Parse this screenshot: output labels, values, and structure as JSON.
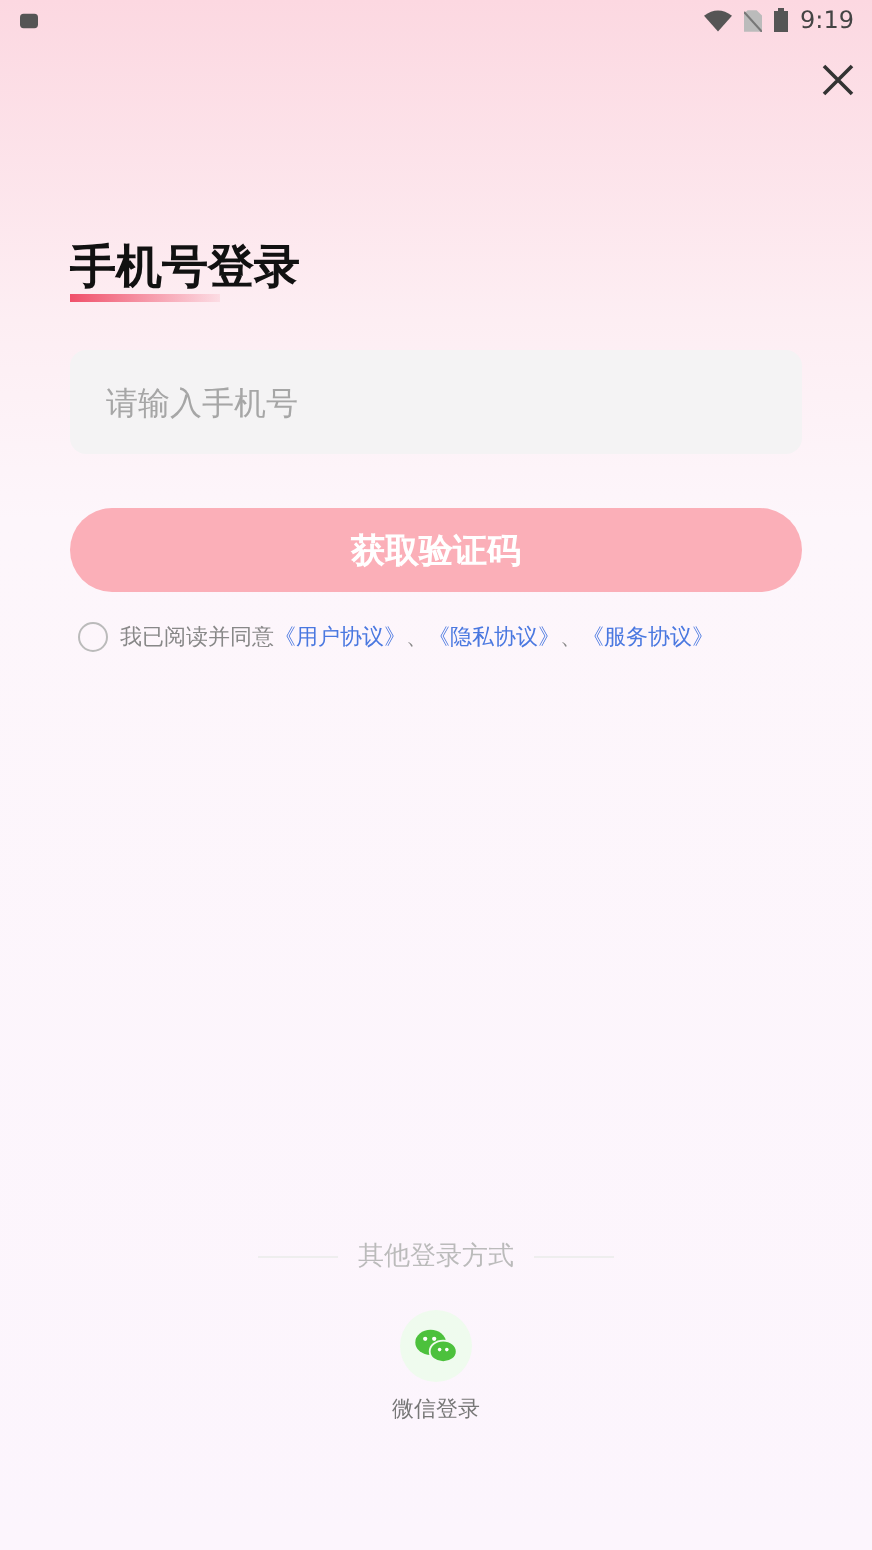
{
  "status_bar": {
    "time": "9:19"
  },
  "title": "手机号登录",
  "phone_field": {
    "placeholder": "请输入手机号"
  },
  "submit_button": {
    "label": "获取验证码",
    "disabled": true
  },
  "agreement": {
    "checked": false,
    "text": "我已阅读并同意",
    "parts": [
      {
        "kind": "link",
        "text": "《用户协议》"
      },
      {
        "kind": "sep",
        "text": "、"
      },
      {
        "kind": "link",
        "text": "《隐私协议》"
      },
      {
        "kind": "sep",
        "text": "、"
      },
      {
        "kind": "link",
        "text": "《服务协议》"
      }
    ]
  },
  "other_login": {
    "heading": "其他登录方式",
    "options": [
      {
        "kind": "wechat",
        "label": "微信登录"
      }
    ]
  }
}
